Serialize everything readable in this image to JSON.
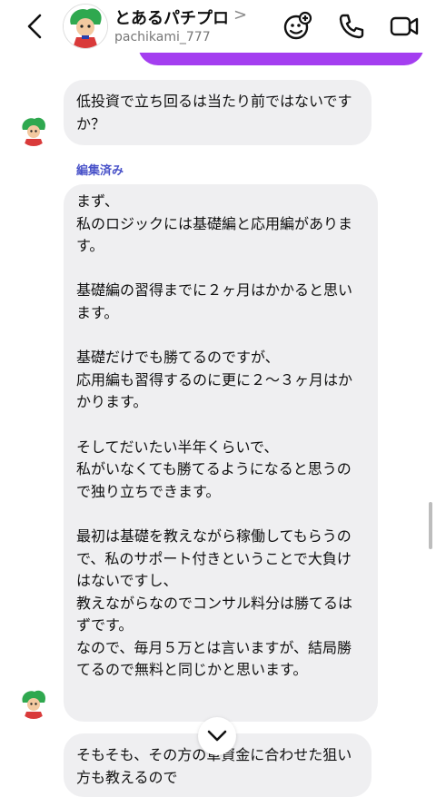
{
  "header": {
    "display_name": "とあるパチプロ",
    "chevron": ">",
    "username": "pachikami_777"
  },
  "icons": {
    "back": "chevron-left-icon",
    "effects": "face-effects-icon",
    "call": "phone-icon",
    "video": "video-camera-icon",
    "scroll_down": "chevron-down-icon"
  },
  "colors": {
    "sent_bubble": "#a43ef0",
    "received_bubble": "#efeff1",
    "edited_label": "#4a53c9"
  },
  "messages": [
    {
      "sender": "received",
      "text": "低投資で立ち回るは当たり前ではないですか？"
    },
    {
      "sender": "received",
      "edited_label": "編集済み",
      "text": "まず、\n私のロジックには基礎編と応用編があります。\n\n基礎編の習得までに２ヶ月はかかると思います。\n\n基礎だけでも勝てるのですが、\n応用編も習得するのに更に２〜３ヶ月はかかります。\n\nそしてだいたい半年くらいで、\n私がいなくても勝てるようになると思うので独り立ちできます。\n\n最初は基礎を教えながら稼働してもらうので、私のサポート付きということで大負けはないですし、\n教えながらなのでコンサル料分は勝てるはずです。\nなので、毎月５万とは言いますが、結局勝てるので無料と同じかと思います。"
    },
    {
      "sender": "received",
      "text": "そもそも、その方の軍資金に合わせた狙い方も教えるので"
    }
  ]
}
